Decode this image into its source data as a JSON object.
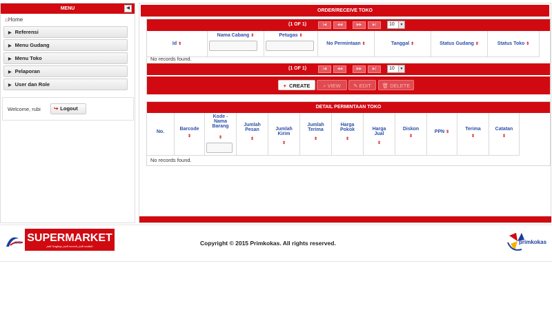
{
  "sidebar": {
    "title": "MENU",
    "collapse_icon": "◀",
    "home": "Home",
    "items": [
      "Referensi",
      "Menu Gudang",
      "Menu Toko",
      "Pelaporan",
      "User dan Role"
    ],
    "welcome": "Welcome, rubi",
    "logout": "Logout"
  },
  "main": {
    "title": "ORDER/RECEIVE TOKO",
    "pager": {
      "text": "(1 OF 1)",
      "first": "|◀",
      "prev": "◀◀",
      "next": "▶▶",
      "last": "▶|",
      "rows_per_page": "10"
    },
    "columns": [
      "Id",
      "Nama Cabang",
      "Petugas",
      "No Permintaan",
      "Tanggal",
      "Status Gudang",
      "Status Toko"
    ],
    "empty_message": "No records found.",
    "actions": {
      "create": "CREATE",
      "view": "VIEW",
      "edit": "EDIT",
      "delete": "DELETE"
    }
  },
  "detail": {
    "title": "DETAIL PERMINTAAN TOKO",
    "columns": [
      "No.",
      "Barcode",
      "Kode - Nama Barang",
      "Jumlah Pesan",
      "Jumlah Kirim",
      "Jumlah Terima",
      "Harga Pokok",
      "Harga Jual",
      "Diskon",
      "PPN",
      "Terima",
      "Catatan"
    ],
    "empty_message": "No records found."
  },
  "footer": {
    "logo_left_text": "SUPERMARKET",
    "logo_left_tagline": "jadi lengkap, jadi murah, jadi mudah",
    "logo_left_mark": "RStar",
    "copyright": "Copyright © 2015 Primkokas. All rights reserved.",
    "logo_right_text": "primkokas"
  },
  "colors": {
    "accent": "#d10a11",
    "header_text": "#2b4fa8"
  }
}
